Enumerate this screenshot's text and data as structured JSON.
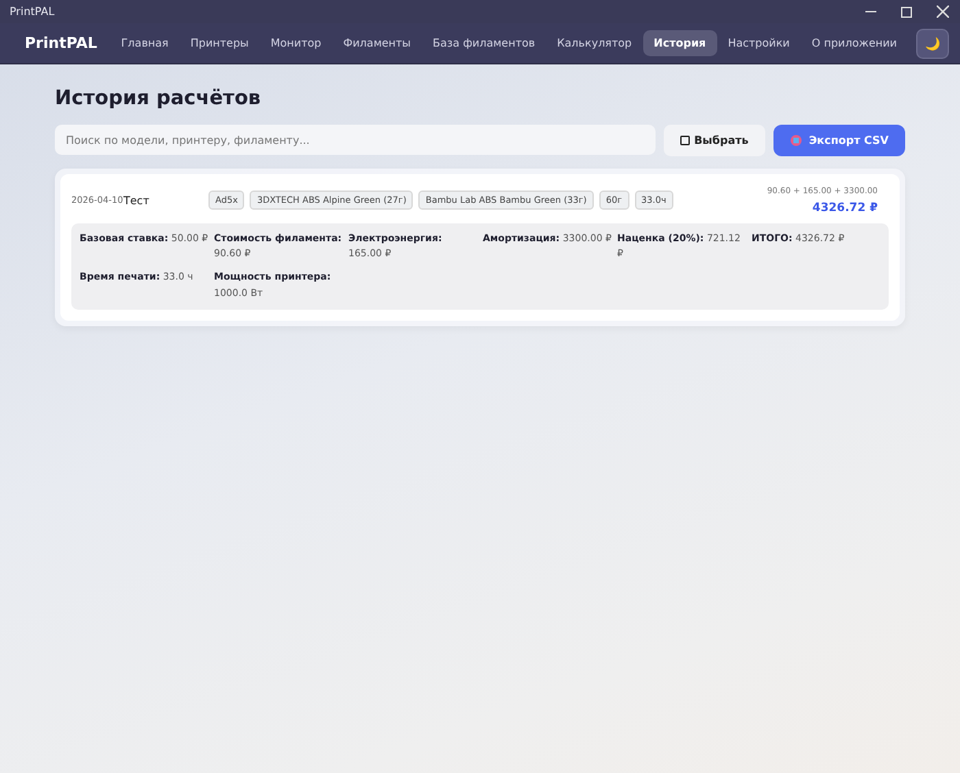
{
  "window": {
    "title": "PrintPAL"
  },
  "app": {
    "logo": "PrintPAL",
    "theme_toggle": "🌙"
  },
  "nav": [
    {
      "label": "Главная",
      "selected": false
    },
    {
      "label": "Принтеры",
      "selected": false
    },
    {
      "label": "Монитор",
      "selected": false
    },
    {
      "label": "Филаменты",
      "selected": false
    },
    {
      "label": "База филаментов",
      "selected": false
    },
    {
      "label": "Калькулятор",
      "selected": false
    },
    {
      "label": "История",
      "selected": true
    },
    {
      "label": "Настройки",
      "selected": false
    },
    {
      "label": "О приложении",
      "selected": false
    }
  ],
  "page": {
    "title": "История расчётов",
    "search": {
      "placeholder": "Поиск по модели, принтеру, филаменту..."
    },
    "select_button": "Выбрать",
    "export_button": "Экспорт CSV"
  },
  "records": [
    {
      "date": "2026-04-10",
      "name": "Тест",
      "tags": [
        "Ad5x",
        "3DXTECH ABS Alpine Green (27г)",
        "Bambu Lab ABS Bambu Green (33г)",
        "60г",
        "33.0ч"
      ],
      "formula": "90.60 + 165.00 + 3300.00",
      "total": "4326.72 ₽",
      "expanded": true,
      "details": [
        "**Базовая ставка:** 50.00 ₽",
        "**Стоимость филамента:** 90.60 ₽",
        "**Электроэнергия:** 165.00 ₽",
        "**Амортизация:** 3300.00 ₽",
        "**Наценка (20%):** 721.12 ₽",
        "**ИТОГО:** 4326.72 ₽",
        "**Время печати:** 33.0 ч",
        "**Мощность принтера:** 1000.0 Вт"
      ]
    }
  ]
}
